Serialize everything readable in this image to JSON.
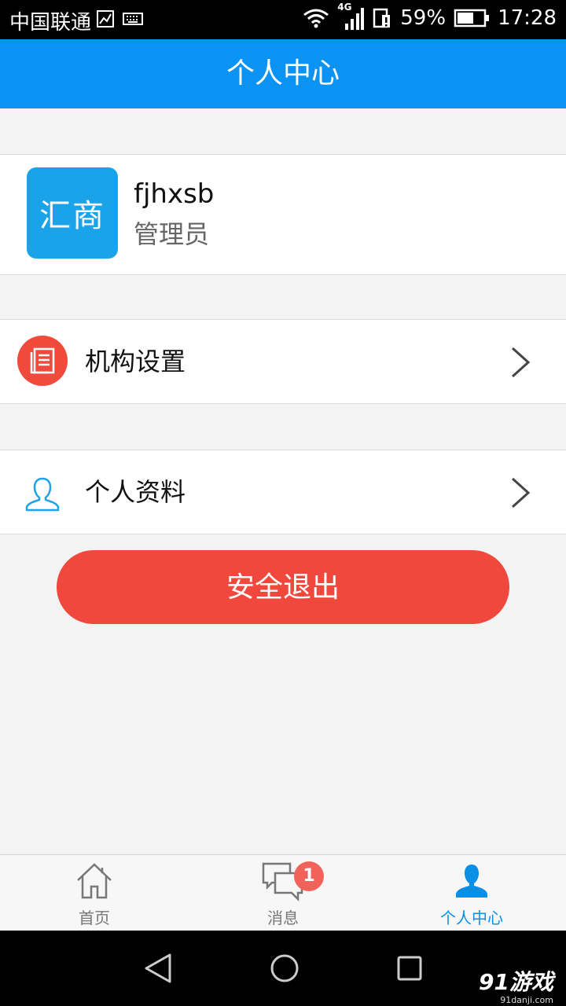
{
  "status_bar": {
    "carrier": "中国联通",
    "network": "4G",
    "battery": "59%",
    "time": "17:28"
  },
  "header": {
    "title": "个人中心"
  },
  "profile": {
    "avatar_text": "汇商",
    "username": "fjhxsb",
    "role": "管理员"
  },
  "menu": {
    "items": [
      {
        "label": "机构设置",
        "icon": "document-list-icon"
      },
      {
        "label": "个人资料",
        "icon": "person-outline-icon"
      }
    ]
  },
  "logout": {
    "label": "安全退出"
  },
  "tabs": {
    "items": [
      {
        "label": "首页",
        "icon": "home-icon"
      },
      {
        "label": "消息",
        "icon": "chat-bubbles-icon",
        "badge": "1"
      },
      {
        "label": "个人中心",
        "icon": "person-icon",
        "active": true
      }
    ]
  },
  "watermark": {
    "main": "91游戏",
    "sub": "91danji.com"
  },
  "colors": {
    "header": "#0a93f2",
    "logout": "#f0483c",
    "org_icon": "#ef4a3c",
    "active_tab": "#0a8fe6"
  }
}
